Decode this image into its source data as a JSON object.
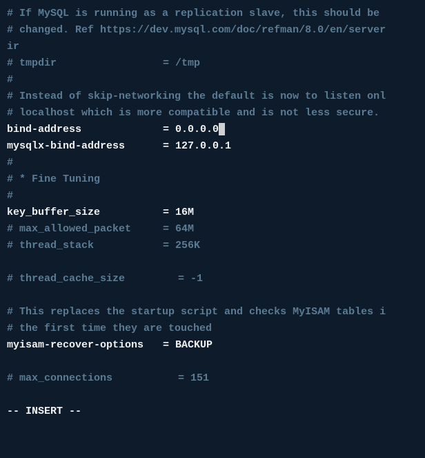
{
  "lines": {
    "c1": "# If MySQL is running as a replication slave, this should be",
    "c2": "# changed. Ref https://dev.mysql.com/doc/refman/8.0/en/server",
    "c3": "ir",
    "c4a": "# tmpdir",
    "c4b": "= /tmp",
    "c5": "#",
    "c6": "# Instead of skip-networking the default is now to listen onl",
    "c7": "# localhost which is more compatible and is not less secure.",
    "bind_key": "bind-address",
    "bind_val": "= 0.0.0.0",
    "mysqlx_key": "mysqlx-bind-address",
    "mysqlx_val": "= 127.0.0.1",
    "c8": "#",
    "c9": "# * Fine Tuning",
    "c10": "#",
    "kbs_key": "key_buffer_size",
    "kbs_val": "= 16M",
    "c11a": "# max_allowed_packet",
    "c11b": "= 64M",
    "c12a": "# thread_stack",
    "c12b": "= 256K",
    "c13a": "# thread_cache_size",
    "c13b": "= -1",
    "c14": "# This replaces the startup script and checks MyISAM tables i",
    "c15": "# the first time they are touched",
    "myisam_key": "myisam-recover-options",
    "myisam_val": "= BACKUP",
    "c16a": "# max_connections",
    "c16b": "= 151"
  },
  "status": "-- INSERT --"
}
